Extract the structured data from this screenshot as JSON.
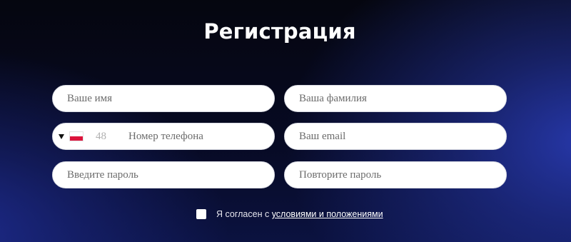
{
  "page": {
    "title": "Регистрация",
    "background_colors": [
      "#05060f",
      "#0b1240",
      "#2637a8"
    ]
  },
  "form": {
    "first_name": {
      "placeholder": "Ваше имя",
      "value": ""
    },
    "last_name": {
      "placeholder": "Ваша фамилия",
      "value": ""
    },
    "phone": {
      "country": "PL",
      "country_code": "48",
      "placeholder": "Номер телефона",
      "value": ""
    },
    "email": {
      "placeholder": "Ваш email",
      "value": ""
    },
    "password": {
      "placeholder": "Введите пароль",
      "value": ""
    },
    "password_repeat": {
      "placeholder": "Повторите пароль",
      "value": ""
    }
  },
  "consent": {
    "checked": false,
    "text": "Я согласен с ",
    "link_text": "условиями и положениями"
  },
  "icons": {
    "dropdown": "caret-down-icon",
    "flag": "flag-poland-icon"
  }
}
